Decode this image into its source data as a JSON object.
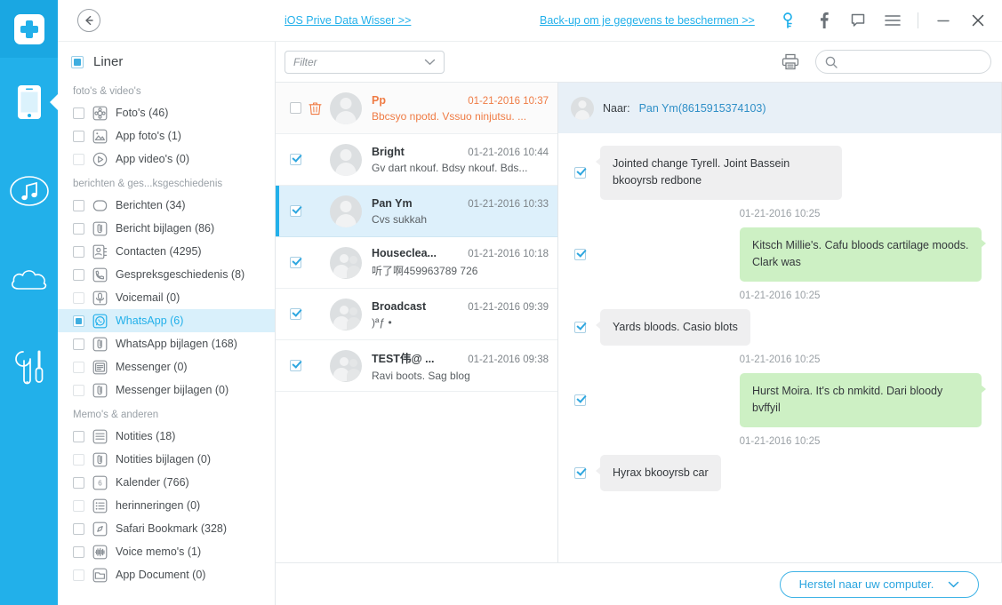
{
  "window": {
    "promo_left": "iOS Prive Data Wisser >>",
    "promo_right": "Back-up om je gegevens te beschermen >>",
    "back_icon": "arrow-left-icon",
    "icons": {
      "key": "key-icon",
      "facebook": "facebook-icon",
      "chat": "speech-bubble-icon",
      "menu": "hamburger-menu-icon",
      "minimize": "minimize-icon",
      "close": "close-icon"
    }
  },
  "rail": {
    "items": [
      {
        "name": "phone-icon",
        "label": "Apparaat",
        "active": true
      },
      {
        "name": "music-note-icon",
        "label": "Muziek",
        "active": false
      },
      {
        "name": "cloud-icon",
        "label": "Cloud",
        "active": false
      },
      {
        "name": "tools-icon",
        "label": "Gereedschap",
        "active": false
      }
    ]
  },
  "sidebar": {
    "header": {
      "label": "Liner",
      "checkbox": "partial"
    },
    "groups": [
      {
        "title": "foto's & video's",
        "items": [
          {
            "label": "Foto's (46)",
            "icon": "photos-icon",
            "checkbox": "unchecked",
            "selected": false
          },
          {
            "label": "App foto's (1)",
            "icon": "app-photos-icon",
            "checkbox": "unchecked",
            "selected": false
          },
          {
            "label": "App video's (0)",
            "icon": "app-videos-icon",
            "checkbox": "dim",
            "selected": false
          }
        ]
      },
      {
        "title": "berichten & ges...ksgeschiedenis",
        "items": [
          {
            "label": "Berichten (34)",
            "icon": "messages-icon",
            "checkbox": "unchecked",
            "selected": false
          },
          {
            "label": "Bericht bijlagen (86)",
            "icon": "attachment-icon",
            "checkbox": "unchecked",
            "selected": false
          },
          {
            "label": "Contacten (4295)",
            "icon": "contacts-icon",
            "checkbox": "unchecked",
            "selected": false
          },
          {
            "label": "Gespreksgeschiedenis (8)",
            "icon": "call-history-icon",
            "checkbox": "unchecked",
            "selected": false
          },
          {
            "label": "Voicemail (0)",
            "icon": "voicemail-icon",
            "checkbox": "dim",
            "selected": false
          },
          {
            "label": "WhatsApp (6)",
            "icon": "whatsapp-icon",
            "checkbox": "partial",
            "selected": true
          },
          {
            "label": "WhatsApp bijlagen (168)",
            "icon": "attachment-icon",
            "checkbox": "unchecked",
            "selected": false
          },
          {
            "label": "Messenger (0)",
            "icon": "messenger-icon",
            "checkbox": "dim",
            "selected": false
          },
          {
            "label": "Messenger bijlagen (0)",
            "icon": "attachment-icon",
            "checkbox": "dim",
            "selected": false
          }
        ]
      },
      {
        "title": "Memo's & anderen",
        "items": [
          {
            "label": "Notities (18)",
            "icon": "notes-icon",
            "checkbox": "unchecked",
            "selected": false
          },
          {
            "label": "Notities bijlagen (0)",
            "icon": "attachment-icon",
            "checkbox": "dim",
            "selected": false
          },
          {
            "label": "Kalender (766)",
            "icon": "calendar-icon",
            "checkbox": "unchecked",
            "selected": false
          },
          {
            "label": "herinneringen (0)",
            "icon": "reminders-icon",
            "checkbox": "dim",
            "selected": false
          },
          {
            "label": "Safari Bookmark (328)",
            "icon": "safari-icon",
            "checkbox": "unchecked",
            "selected": false
          },
          {
            "label": "Voice memo's (1)",
            "icon": "voice-memo-icon",
            "checkbox": "unchecked",
            "selected": false
          },
          {
            "label": "App Document (0)",
            "icon": "app-document-icon",
            "checkbox": "dim",
            "selected": false
          }
        ]
      }
    ]
  },
  "toolbar": {
    "filter_value": "Filter",
    "print_icon": "printer-icon",
    "search_icon": "search-icon",
    "search_value": "",
    "search_placeholder": ""
  },
  "conversations": [
    {
      "name": "Pp",
      "time": "01-21-2016 10:37",
      "snippet": "Bbcsyo npotd. Vssuo ninjutsu. ...",
      "checkbox": "unchecked",
      "deleted": true,
      "group": false,
      "active": false
    },
    {
      "name": "Bright",
      "time": "01-21-2016 10:44",
      "snippet": "Gv dart nkouf. Bdsy nkouf. Bds...",
      "checkbox": "checked",
      "deleted": false,
      "group": false,
      "active": false
    },
    {
      "name": "Pan Ym",
      "time": "01-21-2016 10:33",
      "snippet": "Cvs sukkah",
      "checkbox": "checked",
      "deleted": false,
      "group": false,
      "active": true
    },
    {
      "name": "Houseclea...",
      "time": "01-21-2016 10:18",
      "snippet": "听了啊459963789 726",
      "checkbox": "checked",
      "deleted": false,
      "group": true,
      "active": false
    },
    {
      "name": "Broadcast",
      "time": "01-21-2016 09:39",
      "snippet": ")ªƒ  •",
      "checkbox": "checked",
      "deleted": false,
      "group": true,
      "active": false
    },
    {
      "name": "TEST伟@ ...",
      "time": "01-21-2016 09:38",
      "snippet": "Ravi boots. Sag blog",
      "checkbox": "checked",
      "deleted": false,
      "group": true,
      "active": false
    }
  ],
  "chat": {
    "to_label": "Naar:",
    "to_name": "Pan Ym(8615915374103)",
    "messages": [
      {
        "time": "",
        "text": "Jointed change Tyrell. Joint Bassein bkooyrsb redbone",
        "direction": "in",
        "checkbox": "checked"
      },
      {
        "time": "01-21-2016 10:25",
        "text": "Kitsch Millie's. Cafu bloods cartilage moods. Clark was",
        "direction": "out",
        "checkbox": "checked"
      },
      {
        "time": "01-21-2016 10:25",
        "text": "Yards bloods. Casio blots",
        "direction": "in",
        "checkbox": "checked"
      },
      {
        "time": "01-21-2016 10:25",
        "text": "Hurst Moira. It's cb nmkitd. Dari bloody bvffyil",
        "direction": "out",
        "checkbox": "checked"
      },
      {
        "time": "01-21-2016 10:25",
        "text": "Hyrax bkooyrsb car",
        "direction": "in",
        "checkbox": "checked"
      }
    ]
  },
  "footer": {
    "recover_label": "Herstel naar uw computer.",
    "chevron_icon": "chevron-down-icon"
  },
  "colors": {
    "accent": "#22b0ea",
    "rail": "#22b0ea",
    "selected_row": "#ddf0fb",
    "bubble_in": "#efeff0",
    "bubble_out": "#cdf0c4",
    "deleted_text": "#ef7b44",
    "chat_header": "#e8f0f7"
  }
}
